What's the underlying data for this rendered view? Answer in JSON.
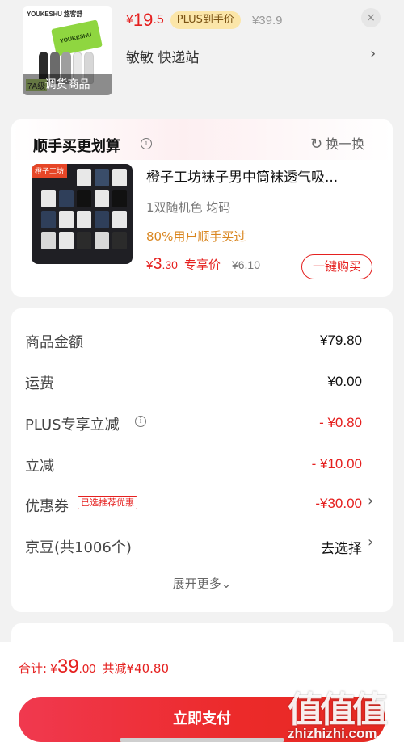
{
  "top_product": {
    "thumb_brand": "YOUKESHU 悠客舒",
    "thumb_box_label": "YOUKESHU",
    "thumb_tag": "7A级",
    "thumb_overlay": "调货商品",
    "price_symbol": "¥",
    "price_int": "19",
    "price_dec": ".5",
    "plus_badge": "PLUS到手价",
    "original_price": "¥39.9",
    "close_icon": "×",
    "station": "敏敏  快递站",
    "chevron": "›"
  },
  "addon": {
    "title": "顺手买更划算",
    "info": "i",
    "refresh_icon": "↻",
    "refresh_label": "换一换",
    "image_tag": "橙子工坊",
    "name": "橙子工坊袜子男中筒袜透气吸...",
    "spec": "1双随机色   均码",
    "note": "80%用户顺手买过",
    "price_symbol": "¥",
    "price_int": "3",
    "price_dec": ".30",
    "price_label": "专享价",
    "original_price": "¥6.10",
    "buy_label": "一键购买"
  },
  "summary": {
    "rows": [
      {
        "label": "商品金额",
        "value": "¥79.80"
      },
      {
        "label": "运费",
        "value": "¥0.00"
      },
      {
        "label": "PLUS专享立减",
        "value": "- ¥0.80"
      },
      {
        "label": "立减",
        "value": "- ¥10.00"
      },
      {
        "label": "优惠券",
        "value": "-¥30.00"
      },
      {
        "label": "京豆(共1006个)",
        "value": "去选择"
      }
    ],
    "coupon_tag": "已选推荐优惠",
    "info": "i",
    "chevron": "›",
    "expand_label": "展开更多",
    "expand_icon": "⌄"
  },
  "bottom": {
    "total_label": "合计:",
    "total_symbol": "¥",
    "total_int": "39",
    "total_dec": ".00",
    "total_saved": "共减¥40.80",
    "pay_label": "立即支付"
  },
  "watermark": {
    "glyphs": "值值值",
    "url": "zhizhizhi.com"
  },
  "colors": {
    "accent_red": "#e5201f",
    "plus_gold": "#fbe6a9",
    "note_orange": "#d9851e"
  }
}
